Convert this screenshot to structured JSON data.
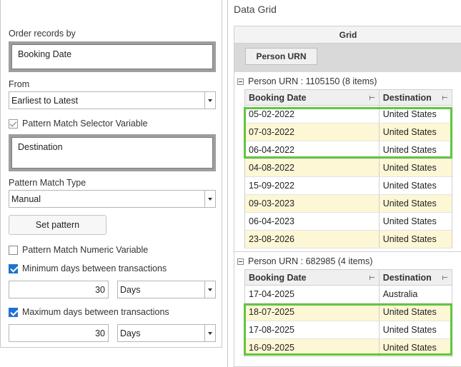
{
  "left": {
    "order_label": "Order records by",
    "order_value": "Booking Date",
    "from_label": "From",
    "from_value": "Earliest to Latest",
    "pattern_selector_label": "Pattern Match Selector Variable",
    "pattern_selector_value": "Destination",
    "pattern_type_label": "Pattern Match Type",
    "pattern_type_value": "Manual",
    "set_pattern_label": "Set pattern",
    "numeric_var_label": "Pattern Match Numeric Variable",
    "min_days_label": "Minimum days between transactions",
    "min_days_value": "30",
    "min_days_unit": "Days",
    "max_days_label": "Maximum days between transactions",
    "max_days_value": "30",
    "max_days_unit": "Days"
  },
  "right": {
    "panel_title": "Data Grid",
    "grid_header": "Grid",
    "groupby_chip": "Person URN",
    "col_booking": "Booking Date",
    "col_destination": "Destination",
    "groups": [
      {
        "label": "Person URN : 1105150 (8 items)",
        "rows": [
          {
            "date": "05-02-2022",
            "dest": "United States"
          },
          {
            "date": "07-03-2022",
            "dest": "United States"
          },
          {
            "date": "06-04-2022",
            "dest": "United States"
          },
          {
            "date": "04-08-2022",
            "dest": "United States"
          },
          {
            "date": "15-09-2022",
            "dest": "United States"
          },
          {
            "date": "09-03-2023",
            "dest": "United States"
          },
          {
            "date": "06-04-2023",
            "dest": "United States"
          },
          {
            "date": "23-08-2026",
            "dest": "United States"
          }
        ]
      },
      {
        "label": "Person URN : 682985 (4 items)",
        "rows": [
          {
            "date": "17-04-2025",
            "dest": "Australia"
          },
          {
            "date": "18-07-2025",
            "dest": "United States"
          },
          {
            "date": "17-08-2025",
            "dest": "United States"
          },
          {
            "date": "16-09-2025",
            "dest": "United States"
          }
        ]
      }
    ]
  },
  "colors": {
    "highlight": "#62c442",
    "alt_row": "#fdf7d6",
    "check_blue": "#1e73d2"
  }
}
